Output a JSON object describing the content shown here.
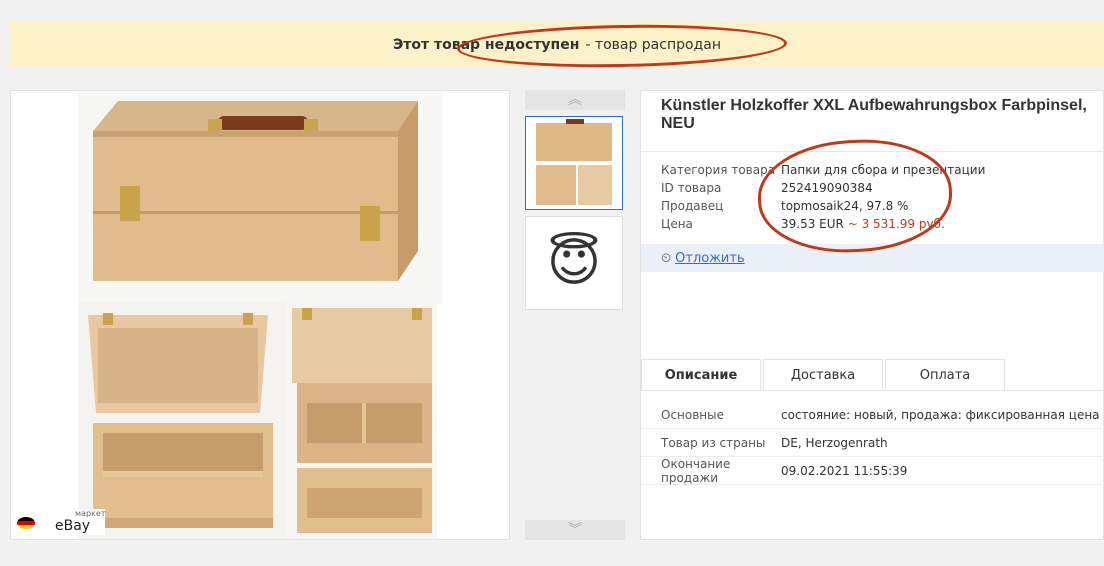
{
  "banner": {
    "bold": "Этот товар недоступен",
    "rest": "- товар распродан"
  },
  "gallery": {
    "flag": [
      "#000000",
      "#dd0000",
      "#ffce00"
    ],
    "badge_small": "маркет",
    "badge_name": "eBay"
  },
  "thumbs": {
    "up_icon": "chevron-double-up-icon",
    "down_icon": "chevron-double-down-icon",
    "emoji": "😇"
  },
  "product": {
    "title": "Künstler Holzkoffer XXL Aufbewahrungsbox Farbpinsel, NEU",
    "props": [
      {
        "k": "Категория товара",
        "v": "Папки для сбора и презентации"
      },
      {
        "k": "ID товара",
        "v": "252419090384"
      },
      {
        "k": "Продавец",
        "v": "topmosaik24, 97.8 %"
      },
      {
        "k": "Цена",
        "v": "39.53 EUR",
        "extra": "~ 3 531.99 руб."
      }
    ],
    "wish_label": "Отложить"
  },
  "tabs": [
    "Описание",
    "Доставка",
    "Оплата"
  ],
  "details": [
    {
      "k": "Основные",
      "v": "состояние: новый, продажа: фиксированная цена"
    },
    {
      "k": "Товар из страны",
      "v": "DE, Herzogenrath"
    },
    {
      "k": "Окончание продажи",
      "v": "09.02.2021 11:55:39"
    }
  ],
  "colors": {
    "banner_bg": "#fcf1c9",
    "annotation": "#c0391b",
    "link": "#2f6fc8"
  }
}
